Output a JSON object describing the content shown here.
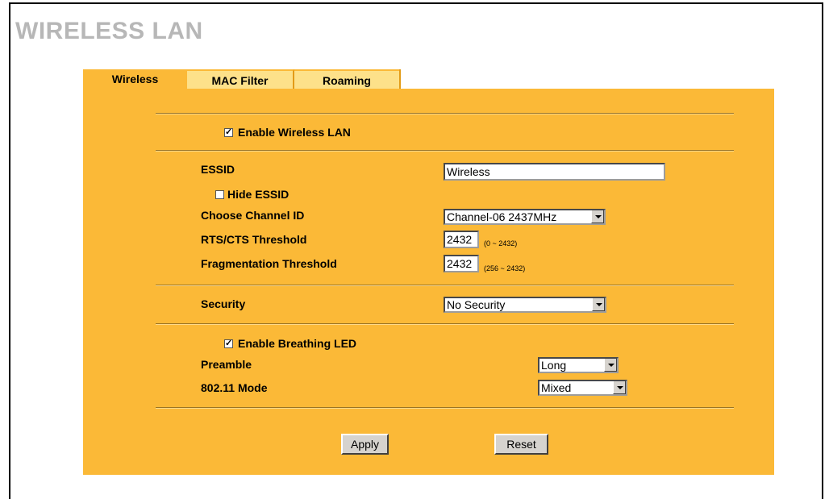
{
  "page": {
    "title": "WIRELESS LAN"
  },
  "tabs": [
    {
      "label": "Wireless",
      "active": true
    },
    {
      "label": "MAC Filter",
      "active": false
    },
    {
      "label": "Roaming",
      "active": false
    }
  ],
  "wireless": {
    "enable_wireless_lan": {
      "label": "Enable Wireless LAN",
      "checked": true
    },
    "essid": {
      "label": "ESSID",
      "value": "Wireless"
    },
    "hide_essid": {
      "label": "Hide ESSID",
      "checked": false
    },
    "channel": {
      "label": "Choose Channel ID",
      "value": "Channel-06 2437MHz"
    },
    "rts": {
      "label": "RTS/CTS  Threshold",
      "value": "2432",
      "range": "(0 ~ 2432)"
    },
    "frag": {
      "label": "Fragmentation  Threshold",
      "value": "2432",
      "range": "(256 ~ 2432)"
    },
    "security": {
      "label": "Security",
      "value": "No Security"
    },
    "breathing_led": {
      "label": "Enable Breathing LED",
      "checked": true
    },
    "preamble": {
      "label": "Preamble",
      "value": "Long"
    },
    "mode": {
      "label": "802.11 Mode",
      "value": "Mixed"
    }
  },
  "buttons": {
    "apply": "Apply",
    "reset": "Reset"
  },
  "colors": {
    "panel": "#fbb937",
    "inactive_tab": "#fde18a",
    "title": "#b7b7b7"
  }
}
